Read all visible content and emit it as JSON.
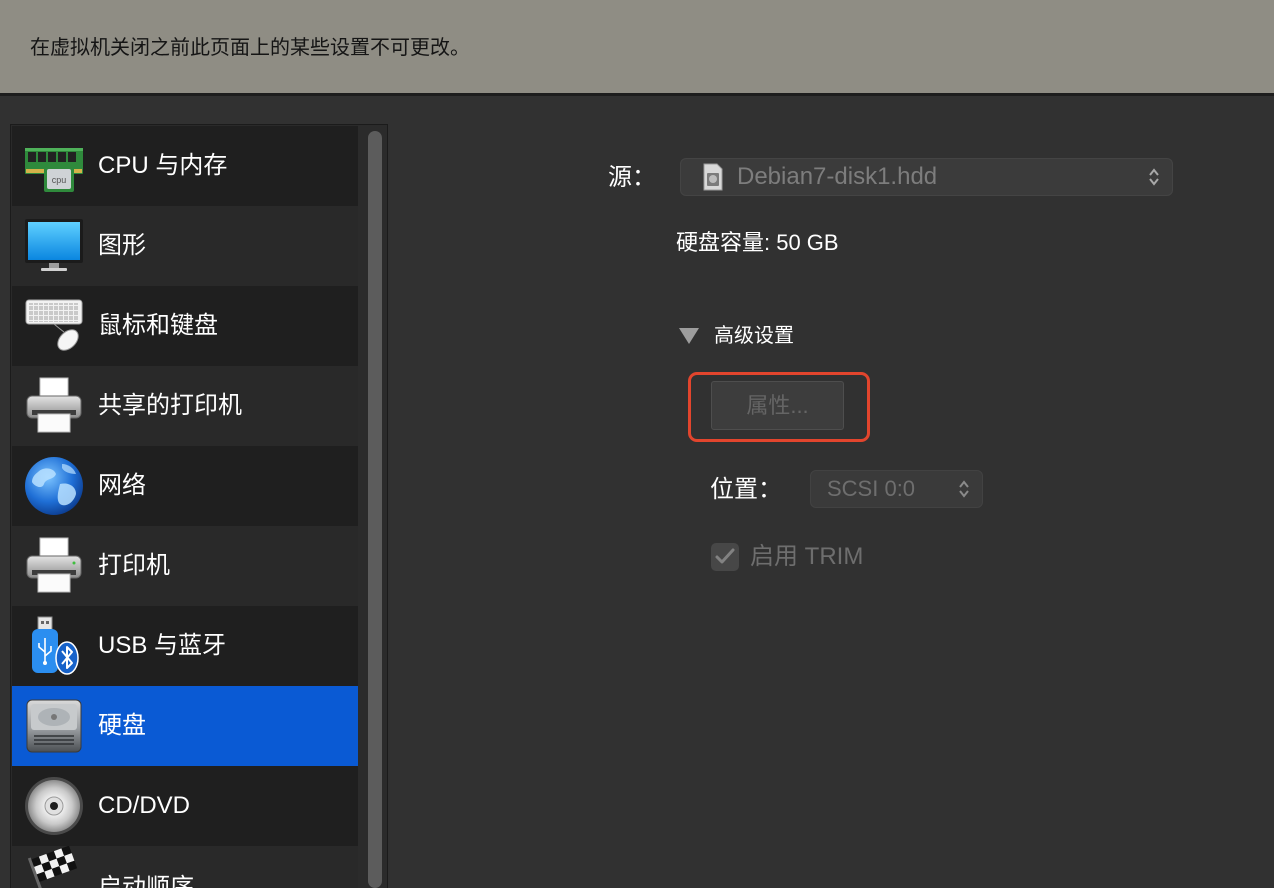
{
  "colors": {
    "banner": "#8f8d84",
    "background": "#313131",
    "selected_row": "#0a5ad4",
    "highlight_border": "#e2452d"
  },
  "banner": {
    "message": "在虚拟机关闭之前此页面上的某些设置不可更改。"
  },
  "sidebar": {
    "items": [
      {
        "label": "CPU 与内存",
        "icon": "cpu-memory-icon",
        "icon_text": "cpu"
      },
      {
        "label": "图形",
        "icon": "monitor-icon"
      },
      {
        "label": "鼠标和键盘",
        "icon": "keyboard-mouse-icon"
      },
      {
        "label": "共享的打印机",
        "icon": "shared-printer-icon"
      },
      {
        "label": "网络",
        "icon": "globe-icon"
      },
      {
        "label": "打印机",
        "icon": "printer-icon"
      },
      {
        "label": "USB 与蓝牙",
        "icon": "usb-bluetooth-icon"
      },
      {
        "label": "硬盘",
        "icon": "hard-disk-icon",
        "selected": true
      },
      {
        "label": "CD/DVD",
        "icon": "cd-dvd-icon"
      },
      {
        "label": "启动顺序",
        "icon": "checkered-flag-icon"
      }
    ]
  },
  "hard_disk": {
    "source_label": "源：",
    "source_value": "Debian7-disk1.hdd",
    "source_icon": "disk-file-icon",
    "capacity": "硬盘容量: 50 GB",
    "advanced": {
      "label": "高级设置",
      "expanded": true,
      "toggle_icon": "disclosure-triangle-down-icon"
    },
    "properties_button": "属性...",
    "location_label": "位置：",
    "location_value": "SCSI 0:0",
    "trim": {
      "label": "启用 TRIM",
      "checked": true,
      "enabled": false
    }
  }
}
